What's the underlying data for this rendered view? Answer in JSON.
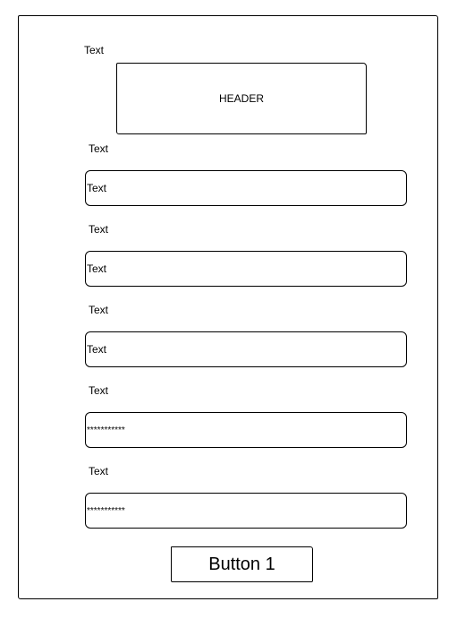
{
  "page": {
    "top_label": "Text",
    "header": "HEADER"
  },
  "fields": [
    {
      "label": "Text",
      "value": "Text"
    },
    {
      "label": "Text",
      "value": "Text"
    },
    {
      "label": "Text",
      "value": "Text"
    },
    {
      "label": "Text",
      "value": "***********"
    },
    {
      "label": "Text",
      "value": "***********"
    }
  ],
  "button": {
    "label": "Button 1"
  }
}
